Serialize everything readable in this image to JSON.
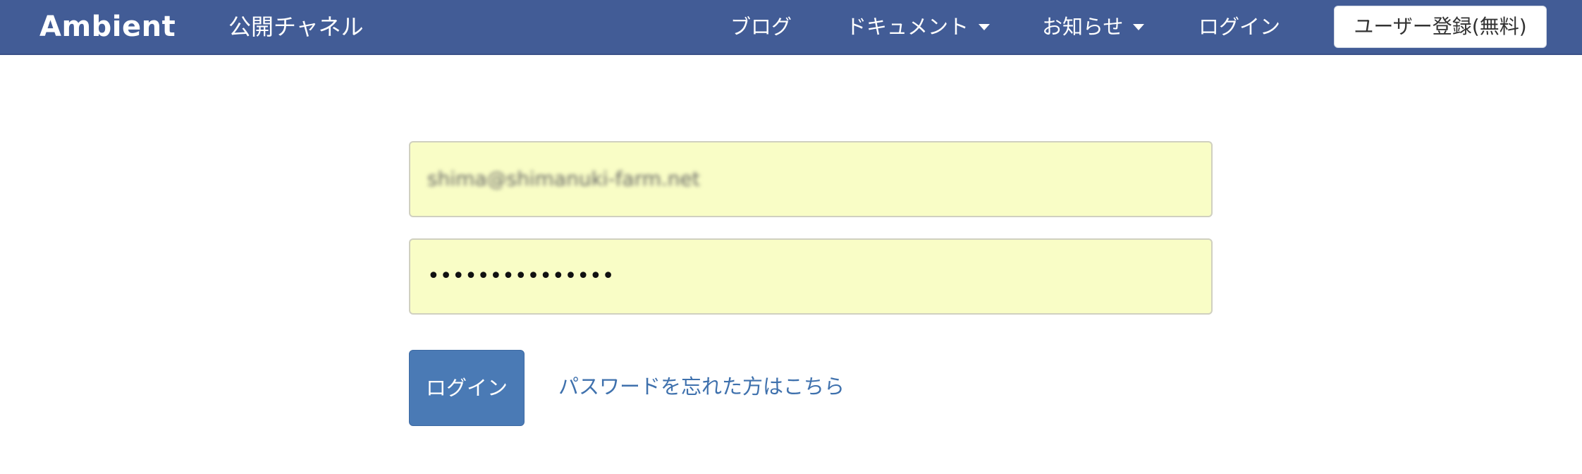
{
  "navbar": {
    "brand": "Ambient",
    "public_channels": "公開チャネル",
    "blog": "ブログ",
    "documents": "ドキュメント",
    "news": "お知らせ",
    "login": "ログイン",
    "register": "ユーザー登録(無料)"
  },
  "form": {
    "email_value": "shima@shimanuki-farm.net",
    "password_masked": "•••••••••••••••",
    "login_button": "ログイン",
    "forgot_password": "パスワードを忘れた方はこちら"
  },
  "colors": {
    "navbar": "#425c96",
    "field_bg": "#f9fdc6",
    "primary_button": "#4a7ab5",
    "link": "#3f71ad"
  }
}
